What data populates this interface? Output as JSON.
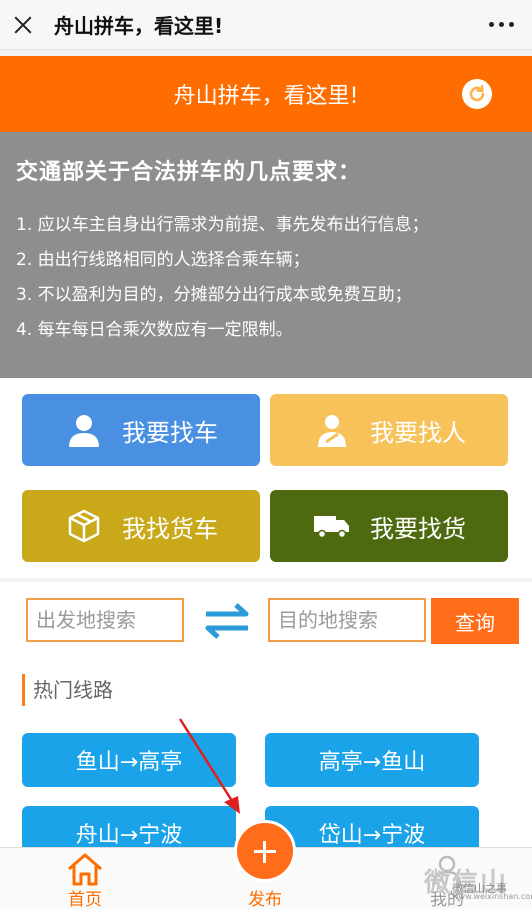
{
  "topbar": {
    "title": "舟山拼车，看这里!"
  },
  "header": {
    "title": "舟山拼车，看这里!"
  },
  "notice": {
    "title": "交通部关于合法拼车的几点要求：",
    "lines": [
      "1. 应以车主自身出行需求为前提、事先发布出行信息；",
      "2. 由出行线路相同的人选择合乘车辆；",
      "3. 不以盈利为目的，分摊部分出行成本或免费互助；",
      "4. 每车每日合乘次数应有一定限制。"
    ]
  },
  "actions": [
    {
      "label": "我要找车",
      "color": "#4a90e2"
    },
    {
      "label": "我要找人",
      "color": "#f8c25a"
    },
    {
      "label": "我找货车",
      "color": "#c9a91a"
    },
    {
      "label": "我要找货",
      "color": "#4e6a10"
    }
  ],
  "search": {
    "from_placeholder": "出发地搜索",
    "to_placeholder": "目的地搜索",
    "button": "查询"
  },
  "hot_routes": {
    "title": "热门线路",
    "routes": [
      "鱼山→高亭",
      "高亭→鱼山",
      "舟山→宁波",
      "岱山→宁波"
    ]
  },
  "tabbar": {
    "home": "首页",
    "publish": "发布",
    "mine": "我的"
  },
  "watermark": {
    "main": "微信山",
    "sub": "微信山之事",
    "url": "www.weixinshan.com"
  },
  "colors": {
    "accent": "#ff6d00",
    "route": "#1aa3e8",
    "notice_bg": "#8e8e8e"
  }
}
